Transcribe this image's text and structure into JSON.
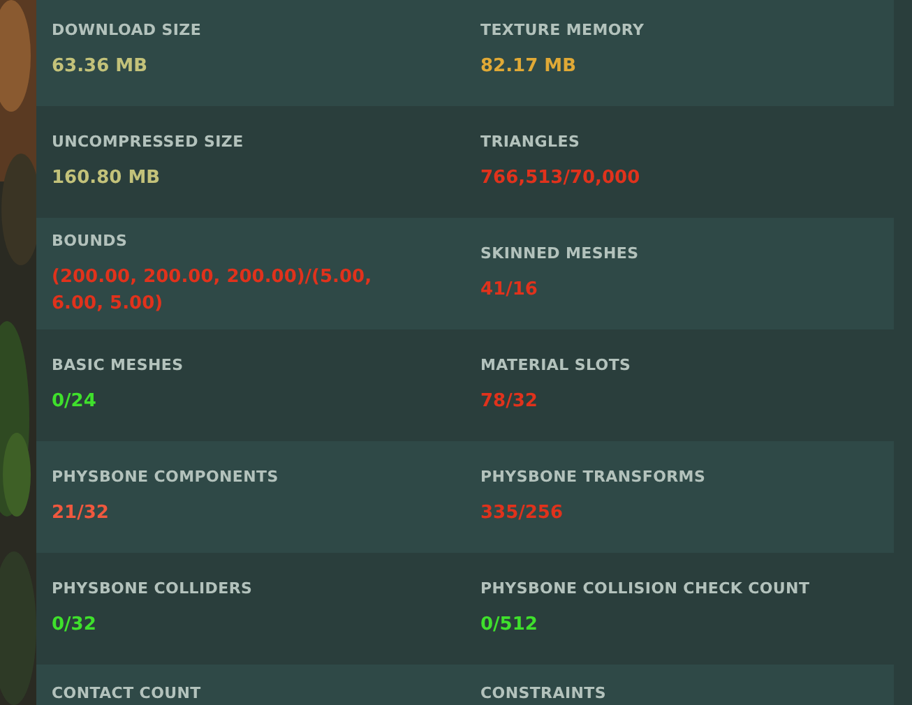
{
  "stats": [
    {
      "label": "DOWNLOAD SIZE",
      "value": "63.36 MB",
      "color": "#c3c27a"
    },
    {
      "label": "TEXTURE MEMORY",
      "value": "82.17 MB",
      "color": "#e0a936"
    },
    {
      "label": "UNCOMPRESSED SIZE",
      "value": "160.80 MB",
      "color": "#c3c27a"
    },
    {
      "label": "TRIANGLES",
      "value": "766,513/70,000",
      "color": "#e0321c"
    },
    {
      "label": "BOUNDS",
      "value": "(200.00, 200.00, 200.00)/(5.00, 6.00, 5.00)",
      "color": "#e0321c"
    },
    {
      "label": "SKINNED MESHES",
      "value": "41/16",
      "color": "#e0321c"
    },
    {
      "label": "BASIC MESHES",
      "value": "0/24",
      "color": "#3fe02c"
    },
    {
      "label": "MATERIAL SLOTS",
      "value": "78/32",
      "color": "#e0321c"
    },
    {
      "label": "PHYSBONE COMPONENTS",
      "value": "21/32",
      "color": "#f0583e"
    },
    {
      "label": "PHYSBONE TRANSFORMS",
      "value": "335/256",
      "color": "#e0321c"
    },
    {
      "label": "PHYSBONE COLLIDERS",
      "value": "0/32",
      "color": "#3fe02c"
    },
    {
      "label": "PHYSBONE COLLISION CHECK COUNT",
      "value": "0/512",
      "color": "#3fe02c"
    },
    {
      "label": "CONTACT COUNT"
    },
    {
      "label": "CONSTRAINTS"
    }
  ]
}
